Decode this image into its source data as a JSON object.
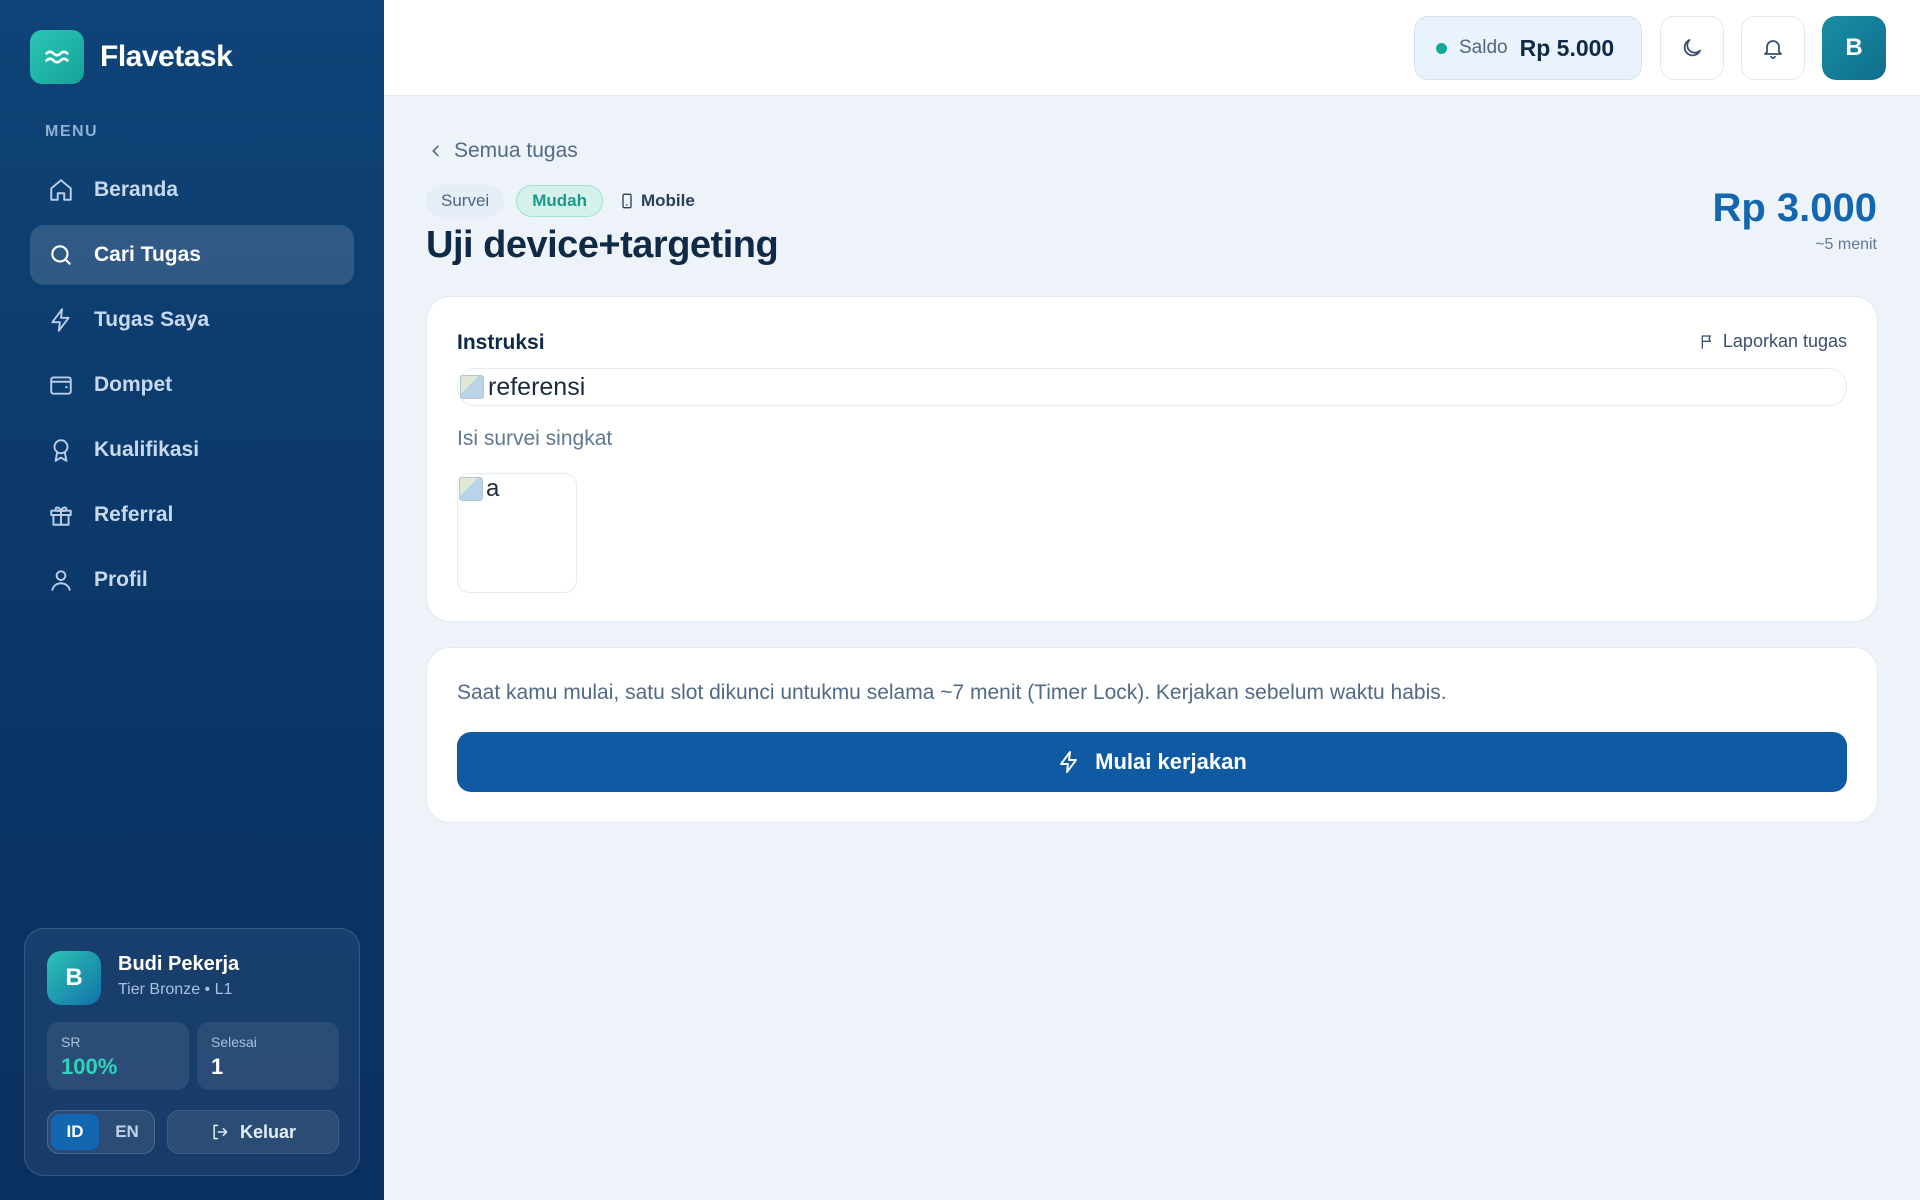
{
  "app": {
    "name": "Flavetask"
  },
  "sidebar": {
    "menu_heading": "MENU",
    "items": [
      {
        "label": "Beranda",
        "icon": "home-icon",
        "active": false
      },
      {
        "label": "Cari Tugas",
        "icon": "search-icon",
        "active": true
      },
      {
        "label": "Tugas Saya",
        "icon": "bolt-icon",
        "active": false
      },
      {
        "label": "Dompet",
        "icon": "wallet-icon",
        "active": false
      },
      {
        "label": "Kualifikasi",
        "icon": "award-icon",
        "active": false
      },
      {
        "label": "Referral",
        "icon": "gift-icon",
        "active": false
      },
      {
        "label": "Profil",
        "icon": "user-icon",
        "active": false
      }
    ],
    "user": {
      "initial": "B",
      "name": "Budi Pekerja",
      "tier": "Tier Bronze • L1",
      "stats": {
        "sr_label": "SR",
        "sr_value": "100%",
        "done_label": "Selesai",
        "done_value": "1"
      },
      "lang": {
        "id": "ID",
        "en": "EN",
        "selected": "ID"
      },
      "logout_label": "Keluar"
    }
  },
  "topbar": {
    "balance_label": "Saldo",
    "balance_value": "Rp 5.000",
    "avatar_initial": "B"
  },
  "task": {
    "back_label": "Semua tugas",
    "category": "Survei",
    "difficulty": "Mudah",
    "device": "Mobile",
    "title": "Uji device+targeting",
    "reward": "Rp 3.000",
    "duration": "~5 menit",
    "instructions_heading": "Instruksi",
    "report_label": "Laporkan tugas",
    "reference_alt": "referensi",
    "description": "Isi survei singkat",
    "attachment_alt": "a",
    "notice": "Saat kamu mulai, satu slot dikunci untukmu selama ~7 menit (Timer Lock). Kerjakan sebelum waktu habis.",
    "start_label": "Mulai kerjakan"
  },
  "colors": {
    "primary": "#0f5aa3",
    "accent": "#14a89a",
    "sidebar": "#0b3668"
  }
}
